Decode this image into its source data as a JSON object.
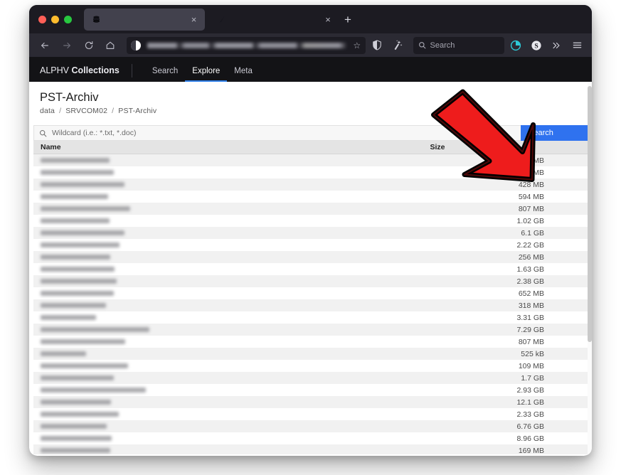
{
  "window": {
    "traffic_lights": [
      "close",
      "minimize",
      "maximize"
    ],
    "tabs": [
      {
        "title": "",
        "favicon": "database-stack-icon",
        "active": true,
        "close_label": "×"
      },
      {
        "title": "",
        "favicon": "dark-arrow-icon",
        "active": false,
        "close_label": "×"
      }
    ],
    "new_tab_label": "+"
  },
  "toolbar": {
    "back_label": "←",
    "forward_label": "→",
    "reload_label": "⟳",
    "home_label": "⌂",
    "url_value": "",
    "bookmark_label": "☆",
    "icons": [
      "shield-icon",
      "wand-icon"
    ],
    "search": {
      "placeholder": "Search",
      "value": ""
    },
    "right_icons": [
      "circle-progress-icon",
      "s-circle-icon",
      "chevron-double-right-icon",
      "hamburger-menu-icon"
    ]
  },
  "site_header": {
    "brand_light": "ALPHV",
    "brand_bold": "Collections",
    "nav": [
      {
        "label": "Search",
        "active": false
      },
      {
        "label": "Explore",
        "active": true
      },
      {
        "label": "Meta",
        "active": false
      }
    ],
    "accent_color": "#2f7fe8"
  },
  "page": {
    "title": "PST-Archiv",
    "breadcrumb": [
      "data",
      "SRVCOM02",
      "PST-Archiv"
    ],
    "breadcrumb_separator": "/",
    "search": {
      "placeholder": "Wildcard (i.e.: *.txt, *.doc)",
      "value": "",
      "button_label": "Search",
      "button_color": "#2f72ef",
      "icon": "magnifier-icon"
    },
    "table": {
      "columns": [
        "Name",
        "Size"
      ],
      "rows": [
        {
          "name": "",
          "name_width": 97,
          "size": "1.03 MB"
        },
        {
          "name": "",
          "name_width": 103,
          "size": "8.4 MB"
        },
        {
          "name": "",
          "name_width": 118,
          "size": "428 MB"
        },
        {
          "name": "",
          "name_width": 95,
          "size": "594 MB"
        },
        {
          "name": "",
          "name_width": 126,
          "size": "807 MB"
        },
        {
          "name": "",
          "name_width": 97,
          "size": "1.02 GB"
        },
        {
          "name": "",
          "name_width": 118,
          "size": "6.1 GB"
        },
        {
          "name": "",
          "name_width": 111,
          "size": "2.22 GB"
        },
        {
          "name": "",
          "name_width": 98,
          "size": "256 MB"
        },
        {
          "name": "",
          "name_width": 104,
          "size": "1.63 GB"
        },
        {
          "name": "",
          "name_width": 107,
          "size": "2.38 GB"
        },
        {
          "name": "",
          "name_width": 103,
          "size": "652 MB"
        },
        {
          "name": "",
          "name_width": 92,
          "size": "318 MB"
        },
        {
          "name": "",
          "name_width": 78,
          "size": "3.31 GB"
        },
        {
          "name": "",
          "name_width": 153,
          "size": "7.29 GB"
        },
        {
          "name": "",
          "name_width": 119,
          "size": "807 MB"
        },
        {
          "name": "",
          "name_width": 64,
          "size": "525 kB"
        },
        {
          "name": "",
          "name_width": 123,
          "size": "109 MB"
        },
        {
          "name": "",
          "name_width": 103,
          "size": "1.7 GB"
        },
        {
          "name": "",
          "name_width": 148,
          "size": "2.93 GB"
        },
        {
          "name": "",
          "name_width": 99,
          "size": "12.1 GB"
        },
        {
          "name": "",
          "name_width": 110,
          "size": "2.33 GB"
        },
        {
          "name": "",
          "name_width": 93,
          "size": "6.76 GB"
        },
        {
          "name": "",
          "name_width": 100,
          "size": "8.96 GB"
        },
        {
          "name": "",
          "name_width": 98,
          "size": "169 MB"
        }
      ]
    }
  },
  "annotation": {
    "type": "arrow",
    "direction": "down-right",
    "fill_color": "#ee1c1c",
    "stroke_color": "#000000",
    "points_at": "search-button"
  }
}
